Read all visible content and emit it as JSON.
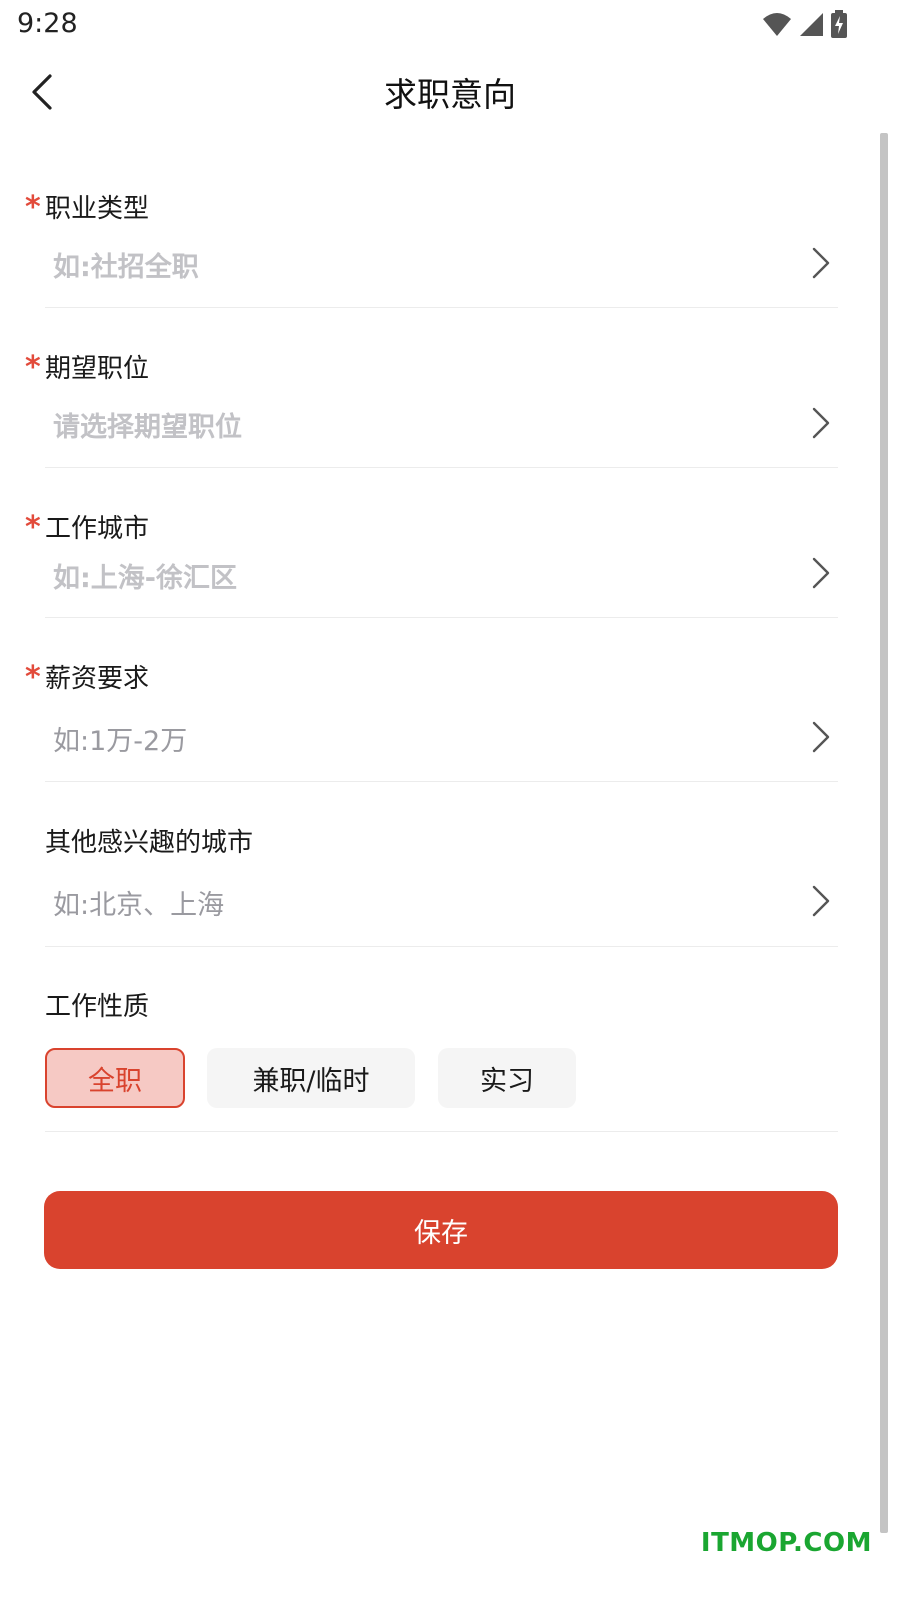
{
  "status_bar": {
    "time": "9:28"
  },
  "header": {
    "title": "求职意向"
  },
  "fields": [
    {
      "label": "职业类型",
      "required": "*",
      "placeholder": "如:社招全职"
    },
    {
      "label": "期望职位",
      "required": "*",
      "placeholder": "请选择期望职位"
    },
    {
      "label": "工作城市",
      "required": "*",
      "placeholder": "如:上海-徐汇区"
    },
    {
      "label": "薪资要求",
      "required": "*",
      "placeholder": "如:1万-2万"
    },
    {
      "label": "其他感兴趣的城市",
      "placeholder": "如:北京、上海"
    }
  ],
  "work_type": {
    "label": "工作性质",
    "options": [
      "全职",
      "兼职/临时",
      "实习"
    ],
    "selected": "全职"
  },
  "save_label": "保存",
  "watermark": "ITMOP.COM",
  "colors": {
    "accent": "#d9432e",
    "required": "#e24b3b",
    "selected_bg": "#f6c9c4"
  }
}
